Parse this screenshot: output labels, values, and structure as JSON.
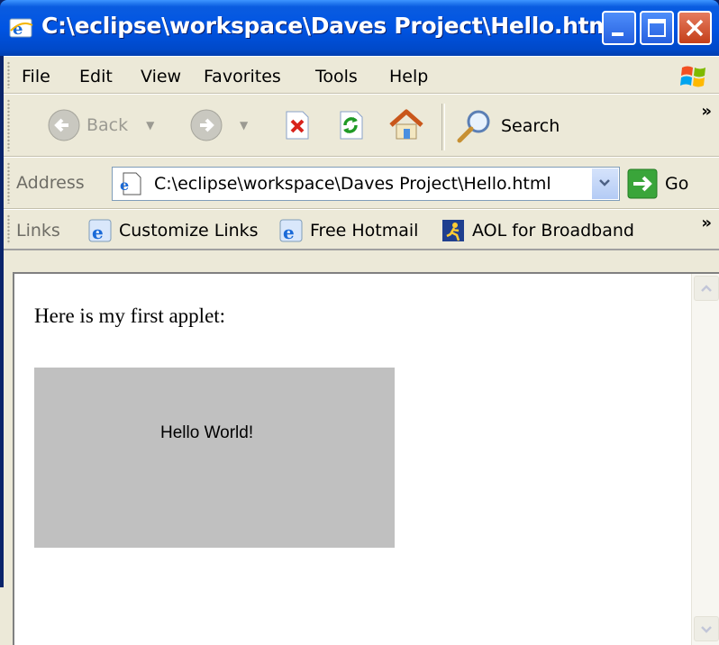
{
  "window": {
    "title": "C:\\eclipse\\workspace\\Daves Project\\Hello.htm..."
  },
  "menu": {
    "items": [
      "File",
      "Edit",
      "View",
      "Favorites",
      "Tools",
      "Help"
    ]
  },
  "toolbar": {
    "back_label": "Back",
    "search_label": "Search",
    "overflow": "»"
  },
  "address": {
    "label": "Address",
    "value": "C:\\eclipse\\workspace\\Daves Project\\Hello.html",
    "go_label": "Go"
  },
  "links": {
    "label": "Links",
    "items": [
      "Customize Links",
      "Free Hotmail",
      "AOL for Broadband"
    ],
    "overflow": "»"
  },
  "page": {
    "intro": "Here is my first applet:",
    "applet_text": "Hello World!"
  },
  "colors": {
    "titlebar": "#0054e3",
    "applet_bg": "#c0c0c0"
  }
}
